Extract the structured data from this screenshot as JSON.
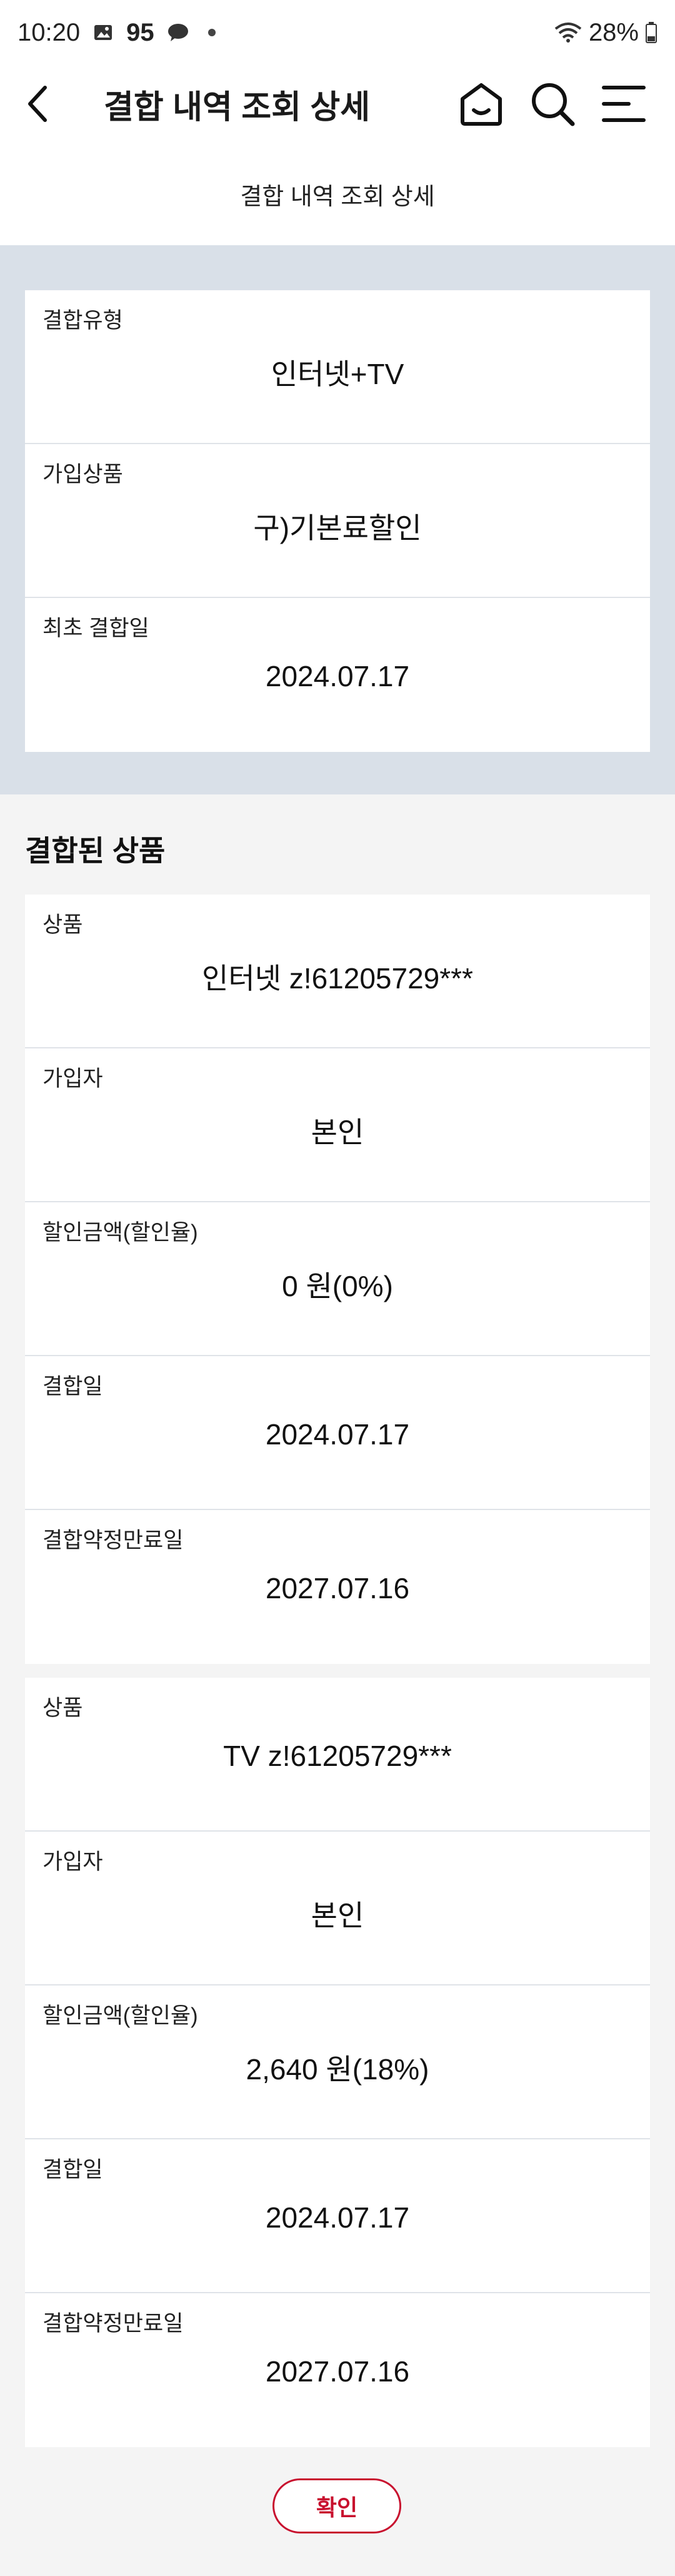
{
  "status": {
    "time": "10:20",
    "notif_count": "95",
    "battery": "28%"
  },
  "header": {
    "title": "결합 내역 조회 상세"
  },
  "subtitle": "결합 내역 조회 상세",
  "summary": [
    {
      "label": "결합유형",
      "value": "인터넷+TV"
    },
    {
      "label": "가입상품",
      "value": "구)기본료할인"
    },
    {
      "label": "최초 결합일",
      "value": "2024.07.17"
    }
  ],
  "section_title": "결합된 상품",
  "products": [
    {
      "rows": [
        {
          "label": "상품",
          "value": "인터넷 z!61205729***"
        },
        {
          "label": "가입자",
          "value": "본인"
        },
        {
          "label": "할인금액(할인율)",
          "value": "0 원(0%)"
        },
        {
          "label": "결합일",
          "value": "2024.07.17"
        },
        {
          "label": "결합약정만료일",
          "value": "2027.07.16"
        }
      ]
    },
    {
      "rows": [
        {
          "label": "상품",
          "value": "TV z!61205729***"
        },
        {
          "label": "가입자",
          "value": "본인"
        },
        {
          "label": "할인금액(할인율)",
          "value": "2,640 원(18%)"
        },
        {
          "label": "결합일",
          "value": "2024.07.17"
        },
        {
          "label": "결합약정만료일",
          "value": "2027.07.16"
        }
      ]
    }
  ],
  "confirm_label": "확인",
  "colors": {
    "accent": "#c8102e",
    "summary_bg": "#d9e0e8",
    "page_bg": "#f4f4f4"
  }
}
